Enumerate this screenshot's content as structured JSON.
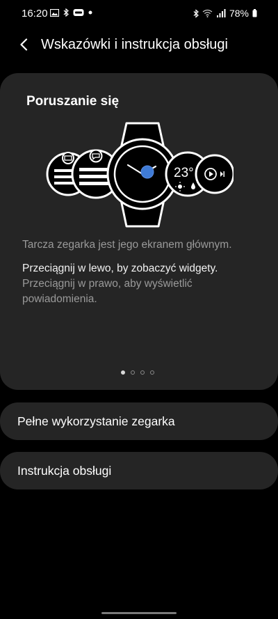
{
  "status_bar": {
    "time": "16:20",
    "battery": "78%"
  },
  "header": {
    "title": "Wskazówki i instrukcja obsługi"
  },
  "card": {
    "title": "Poruszanie się",
    "watch_temp": "23°",
    "description": "Tarcza zegarka jest jego ekranem głównym.",
    "swipe_left": "Przeciągnij w lewo, by zobaczyć widgety.",
    "swipe_right": "Przeciągnij w prawo, aby wyświetlić powiadomienia.",
    "page_count": 4,
    "active_page": 1
  },
  "menu": {
    "full_usage": "Pełne wykorzystanie zegarka",
    "manual": "Instrukcja obsługi"
  },
  "colors": {
    "accent": "#3f7bd6",
    "card_bg": "#252525"
  }
}
